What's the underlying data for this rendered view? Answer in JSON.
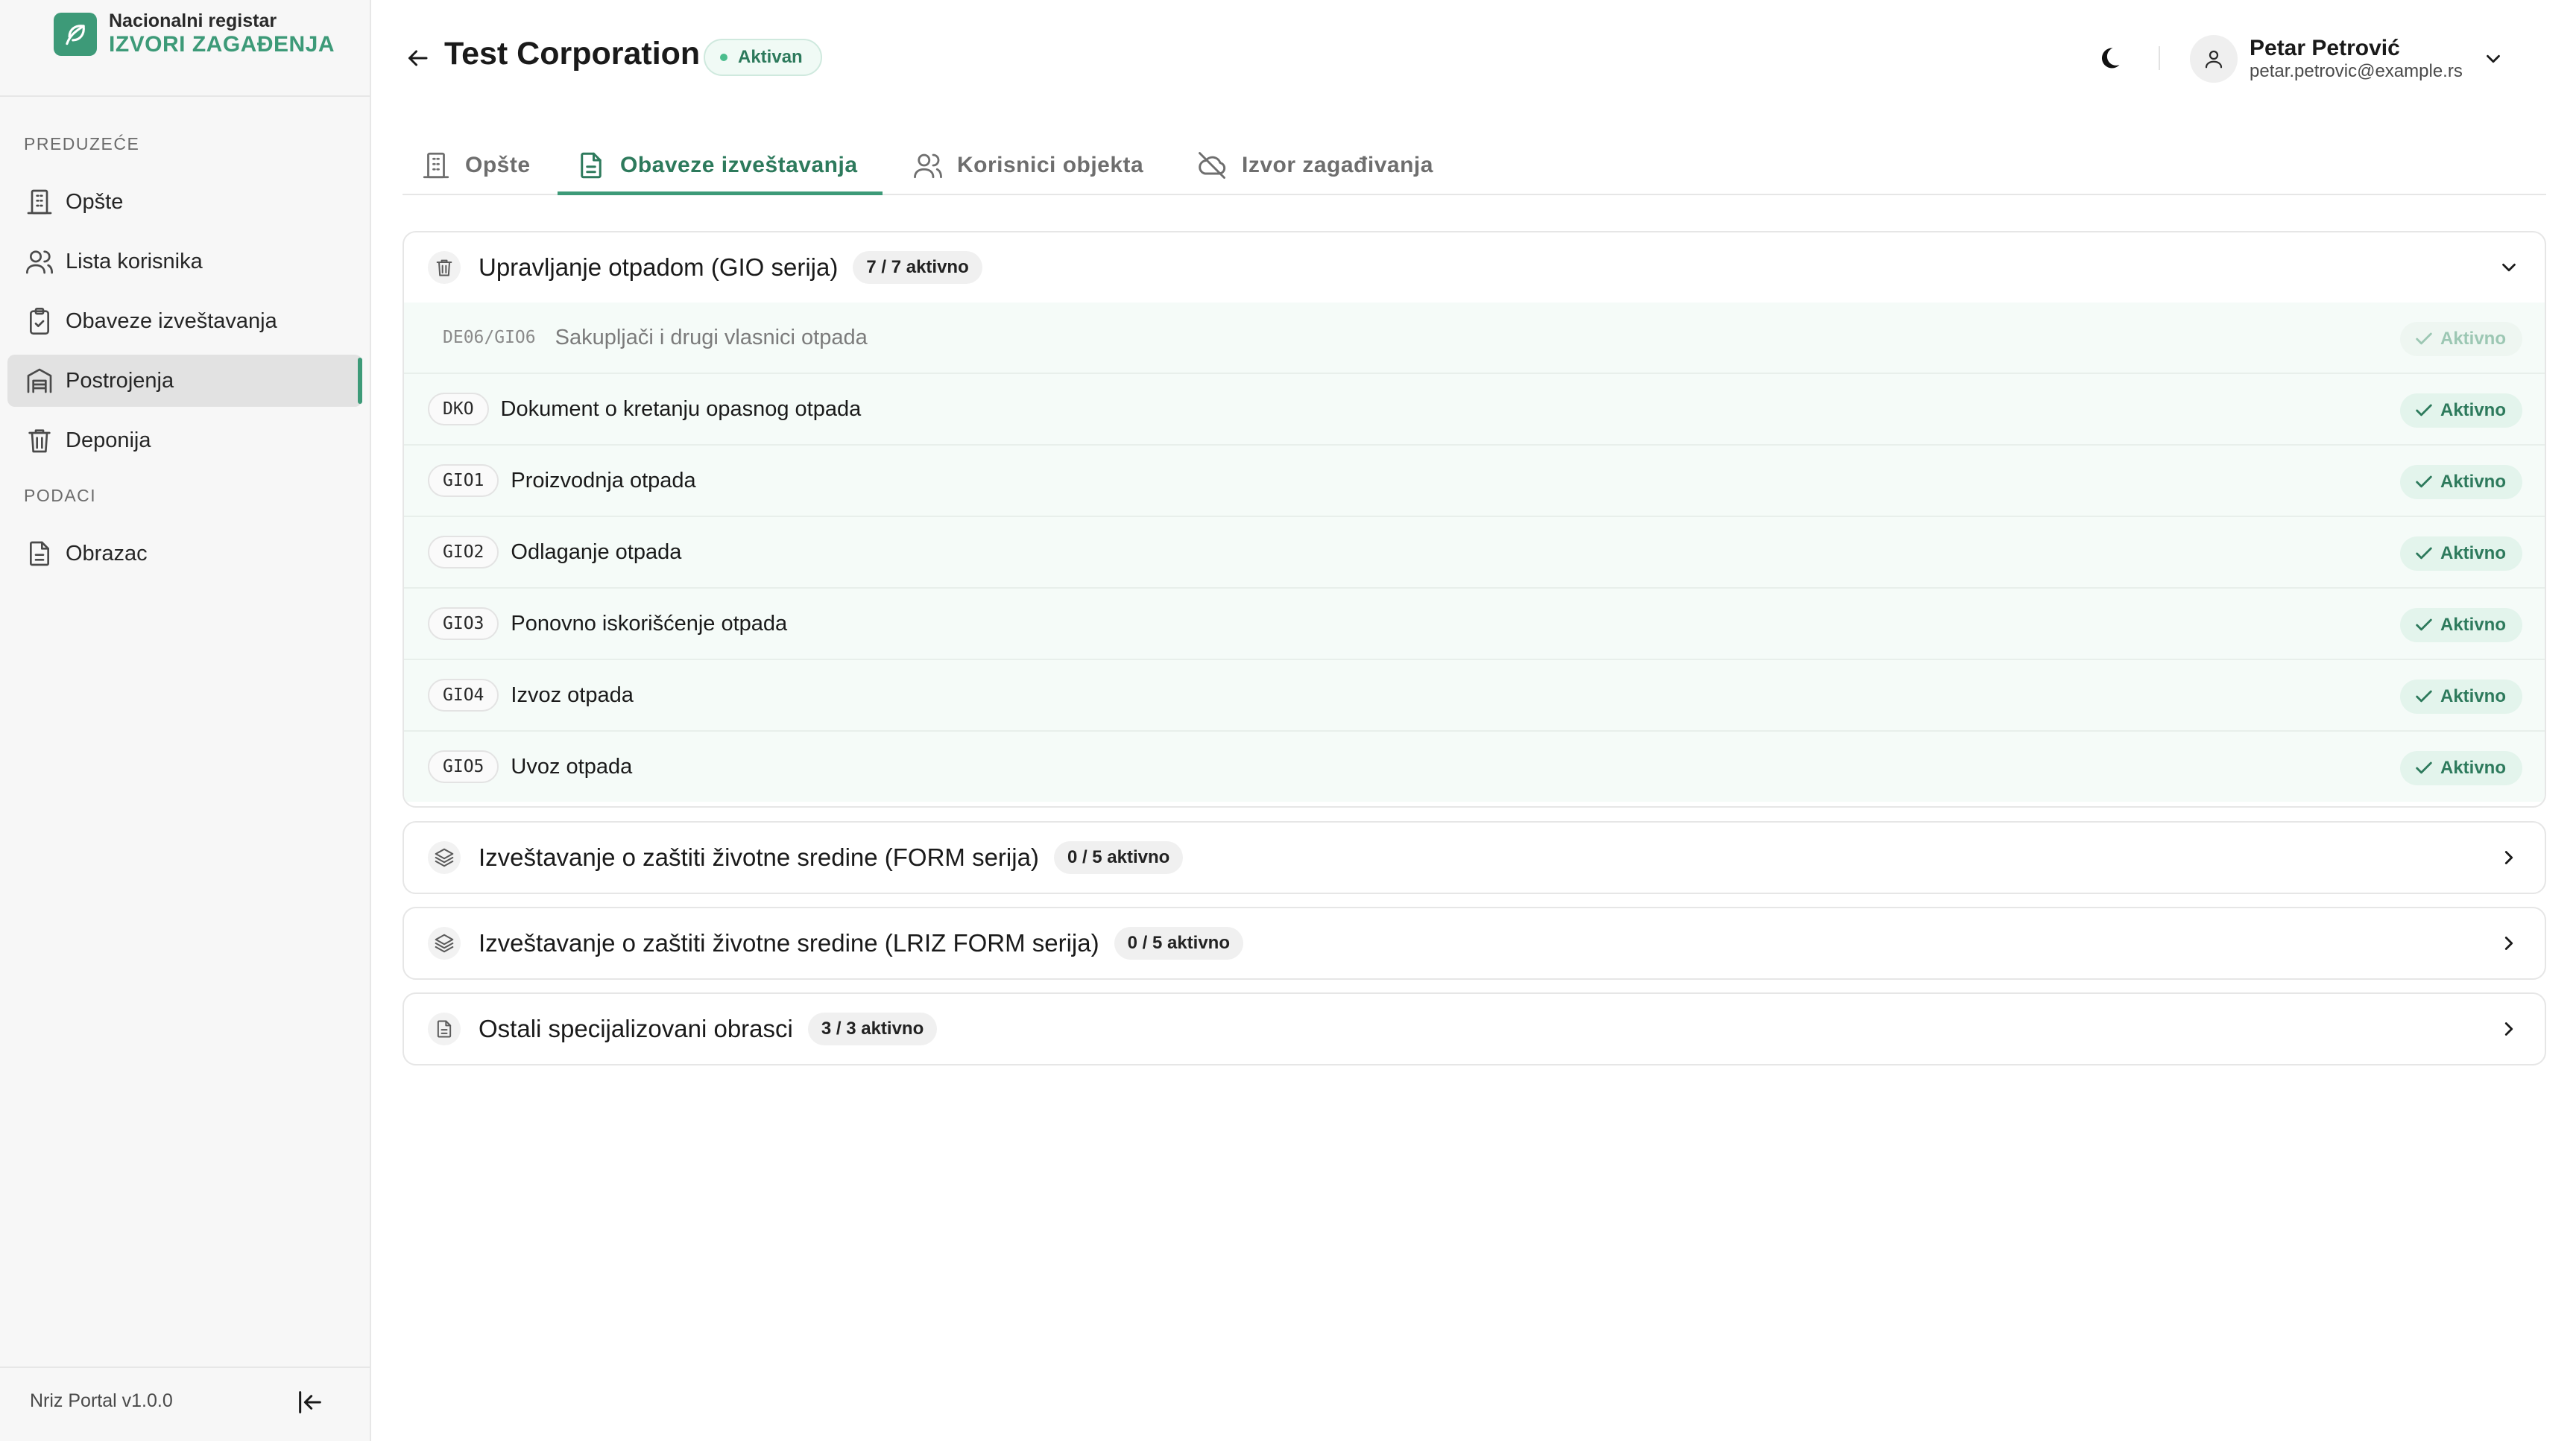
{
  "brand": {
    "line1": "Nacionalni registar",
    "line2": "IZVORI ZAGAĐENJA"
  },
  "sidebar": {
    "section1": "PREDUZEĆE",
    "section2": "PODACI",
    "items": [
      {
        "label": "Opšte",
        "icon": "building-icon"
      },
      {
        "label": "Lista korisnika",
        "icon": "users-icon"
      },
      {
        "label": "Obaveze izveštavanja",
        "icon": "clipboard-check-icon"
      },
      {
        "label": "Postrojenja",
        "icon": "warehouse-icon",
        "active": true
      },
      {
        "label": "Deponija",
        "icon": "trash-icon"
      },
      {
        "label": "Obrazac",
        "icon": "document-icon"
      }
    ],
    "version": "Nriz Portal v1.0.0"
  },
  "header": {
    "title": "Test Corporation",
    "status": "Aktivan",
    "user_name": "Petar Petrović",
    "user_email": "petar.petrovic@example.rs"
  },
  "tabs": [
    {
      "label": "Opšte",
      "icon": "building-icon"
    },
    {
      "label": "Obaveze izveštavanja",
      "icon": "document-icon",
      "active": true
    },
    {
      "label": "Korisnici objekta",
      "icon": "users-icon"
    },
    {
      "label": "Izvor zagađivanja",
      "icon": "cloud-off-icon"
    }
  ],
  "groups": [
    {
      "title": "Upravljanje otpadom (GIO serija)",
      "count": "7 / 7 aktivno",
      "expanded": true,
      "rows": [
        {
          "code": "DE06/GIO6",
          "label": "Sakupljači i drugi vlasnici otpada",
          "status": "Aktivno"
        },
        {
          "code": "DKO",
          "label": "Dokument o kretanju opasnog otpada",
          "status": "Aktivno"
        },
        {
          "code": "GIO1",
          "label": "Proizvodnja otpada",
          "status": "Aktivno"
        },
        {
          "code": "GIO2",
          "label": "Odlaganje otpada",
          "status": "Aktivno"
        },
        {
          "code": "GIO3",
          "label": "Ponovno iskorišćenje otpada",
          "status": "Aktivno"
        },
        {
          "code": "GIO4",
          "label": "Izvoz otpada",
          "status": "Aktivno"
        },
        {
          "code": "GIO5",
          "label": "Uvoz otpada",
          "status": "Aktivno"
        }
      ]
    },
    {
      "title": "Izveštavanje o zaštiti životne sredine (FORM serija)",
      "count": "0 / 5 aktivno",
      "expanded": false
    },
    {
      "title": "Izveštavanje o zaštiti životne sredine (LRIZ FORM serija)",
      "count": "0 / 5 aktivno",
      "expanded": false
    },
    {
      "title": "Ostali specijalizovani obrasci",
      "count": "3 / 3 aktivno",
      "expanded": false
    }
  ],
  "colors": {
    "accent": "#3d9a78",
    "accent_dark": "#2d7a5c",
    "badge_bg": "#e3f4ec",
    "row_bg": "#f5fbf8",
    "sidebar_bg": "#f7f7f7"
  }
}
